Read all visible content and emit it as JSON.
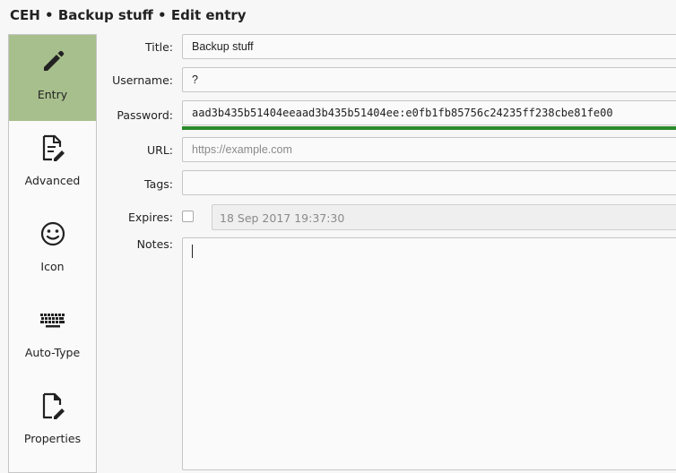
{
  "window": {
    "title": "CEH • Backup stuff • Edit entry"
  },
  "sidebar": {
    "items": [
      {
        "label": "Entry",
        "icon": "pencil-icon",
        "active": true
      },
      {
        "label": "Advanced",
        "icon": "document-edit-icon",
        "active": false
      },
      {
        "label": "Icon",
        "icon": "smiley-icon",
        "active": false
      },
      {
        "label": "Auto-Type",
        "icon": "keyboard-icon",
        "active": false
      },
      {
        "label": "Properties",
        "icon": "file-edit-icon",
        "active": false
      }
    ],
    "active_color": "#a7bf8c"
  },
  "form": {
    "title_label": "Title:",
    "title_value": "Backup stuff",
    "username_label": "Username:",
    "username_value": "?",
    "password_label": "Password:",
    "password_value": "aad3b435b51404eeaad3b435b51404ee:e0fb1fb85756c24235ff238cbe81fe00",
    "password_strength_color": "#2a8a2a",
    "url_label": "URL:",
    "url_placeholder": "https://example.com",
    "tags_label": "Tags:",
    "tags_value": "",
    "expires_label": "Expires:",
    "expires_checked": false,
    "expires_value": "18 Sep 2017 19:37:30",
    "notes_label": "Notes:",
    "notes_value": ""
  }
}
